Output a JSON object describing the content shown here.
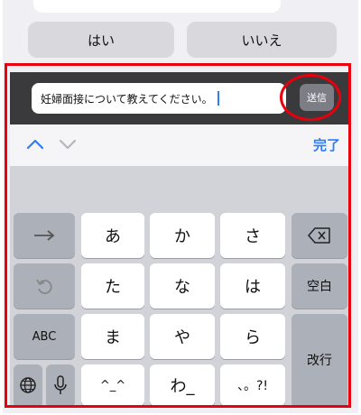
{
  "quick_replies": {
    "yes": "はい",
    "no": "いいえ"
  },
  "input": {
    "value": "妊婦面接について教えてください。",
    "send_label": "送信"
  },
  "accessory": {
    "done_label": "完了"
  },
  "keyboard": {
    "row1": [
      "あ",
      "か",
      "さ"
    ],
    "row2": [
      "た",
      "な",
      "は"
    ],
    "row3": [
      "ま",
      "や",
      "ら"
    ],
    "row4": [
      "^_^",
      "わ_",
      "、。?!"
    ],
    "abc_label": "ABC",
    "space_label": "空白",
    "return_label": "改行"
  },
  "colors": {
    "accent": "#2f7cf6",
    "annotation": "#e8000c"
  }
}
